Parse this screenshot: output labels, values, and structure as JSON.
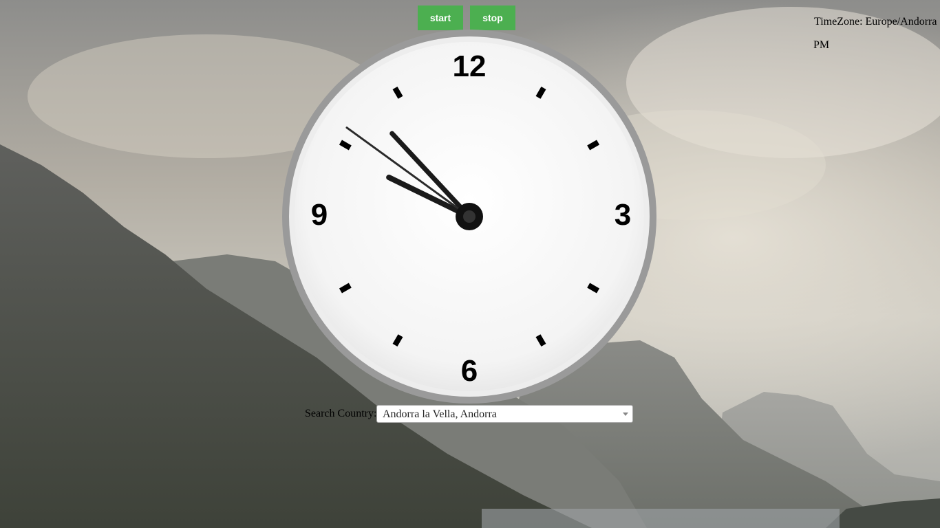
{
  "controls": {
    "start_label": "start",
    "stop_label": "stop"
  },
  "info": {
    "timezone_text": "TimeZone: Europe/Andorra",
    "meridiem": "PM"
  },
  "clock": {
    "numerals": {
      "twelve": "12",
      "three": "3",
      "six": "6",
      "nine": "9"
    },
    "time": {
      "hour": 9,
      "minute": 52,
      "second": 51
    }
  },
  "search": {
    "label": "Search Country:",
    "selected_value": "Andorra la Vella, Andorra"
  },
  "colors": {
    "button_green": "#4caf50",
    "clock_rim": "#9a9a9a",
    "hand": "#1a1a1a"
  }
}
